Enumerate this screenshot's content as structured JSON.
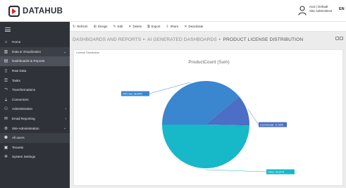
{
  "app": {
    "logo_text": "DATAHUB",
    "user_line1": "root ( Default",
    "user_line2": "Site Administrat",
    "lang": "EN"
  },
  "sidebar": {
    "items": [
      {
        "label": "Home",
        "icon": "home-icon"
      },
      {
        "label": "Data & Visualization",
        "icon": "chart-icon",
        "chevron": "⌄"
      },
      {
        "label": "Dashboards & Reports",
        "icon": "dashboard-icon"
      },
      {
        "label": "Raw Data",
        "icon": "document-icon"
      },
      {
        "label": "Tasks",
        "icon": "tasks-icon"
      },
      {
        "label": "Transformations",
        "icon": "transform-icon"
      },
      {
        "label": "Connectors",
        "icon": "plug-icon"
      },
      {
        "label": "Administration",
        "icon": "admin-icon",
        "chevron": "‹"
      },
      {
        "label": "Email Reporting",
        "icon": "mail-icon",
        "chevron": "‹"
      },
      {
        "label": "Site-Administration",
        "icon": "site-admin-icon",
        "chevron": "⌄"
      },
      {
        "label": "All users",
        "icon": "users-icon"
      },
      {
        "label": "Tenants",
        "icon": "tenant-icon"
      },
      {
        "label": "System Settings",
        "icon": "settings-icon"
      }
    ]
  },
  "toolbar": {
    "refresh": "Refresh",
    "design": "Design",
    "edit": "Edit",
    "delete": "Delete",
    "export": "Export",
    "share": "Share",
    "deactivate": "Deactivate"
  },
  "breadcrumb": {
    "level1": "DASHBOARDS AND REPORTS",
    "level2": "AI GENERATED DASHBOARDS",
    "current": "PRODUCT LICENSE DISTRIBUTION"
  },
  "panel": {
    "label": "License Distribution",
    "title": "ProductCount (Sum)"
  },
  "chart_data": {
    "type": "pie",
    "title": "ProductCount (Sum)",
    "slices": [
      {
        "name": "OPC-Ne",
        "value": 38.8,
        "label": "OPC-Ne: 38.80%",
        "color": "#3a86cf"
      },
      {
        "name": "Commercial",
        "value": 11.53,
        "label": "Commercial: 11.53%",
        "color": "#4a6fc4"
      },
      {
        "name": "Other",
        "value": 49.67,
        "label": "Other: 49.67%",
        "color": "#17b8c8"
      }
    ]
  }
}
